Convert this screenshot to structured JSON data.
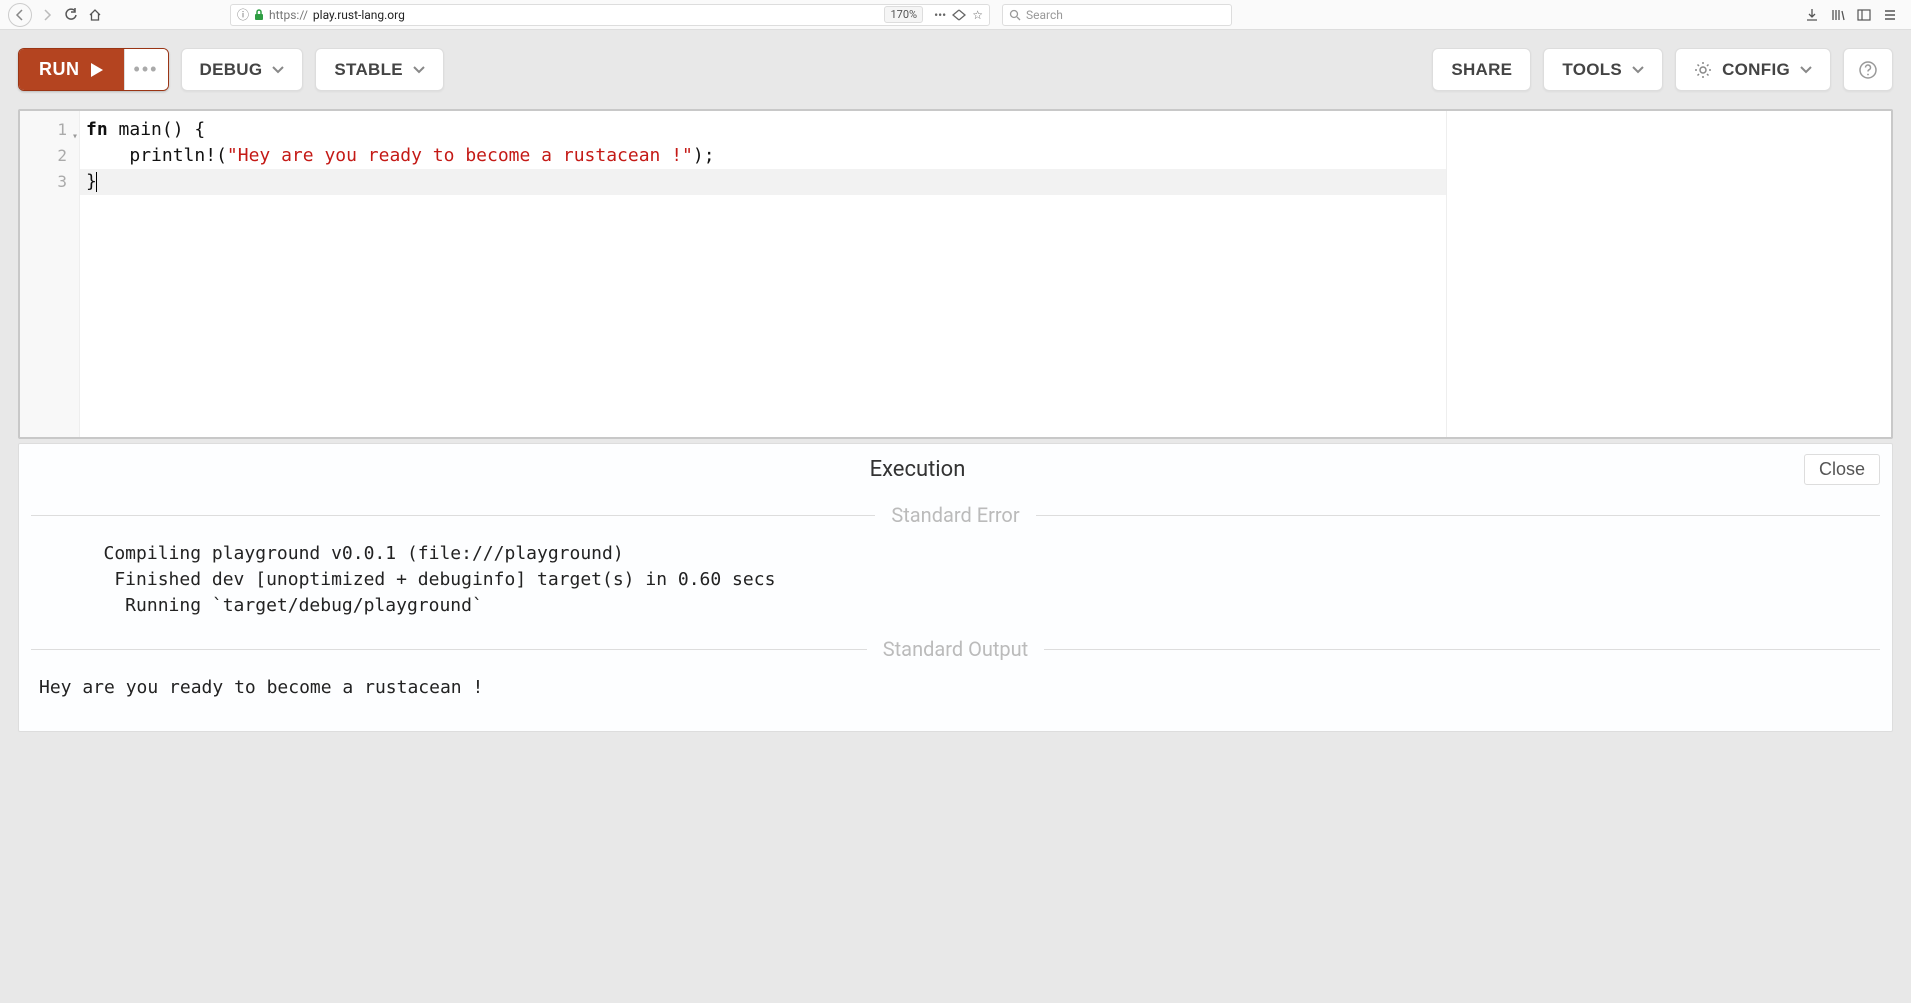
{
  "browser": {
    "url_prefix": "https://",
    "url_host": "play.rust-lang.org",
    "zoom": "170%",
    "search_placeholder": "Search"
  },
  "toolbar": {
    "run_label": "RUN",
    "debug_label": "DEBUG",
    "stable_label": "STABLE",
    "share_label": "SHARE",
    "tools_label": "TOOLS",
    "config_label": "CONFIG"
  },
  "editor": {
    "lines": [
      {
        "n": "1",
        "fold": true
      },
      {
        "n": "2",
        "fold": false
      },
      {
        "n": "3",
        "fold": false
      }
    ],
    "code": {
      "l1_kw": "fn",
      "l1_rest": " main() {",
      "l2_indent": "    ",
      "l2_call": "println!",
      "l2_paren_open": "(",
      "l2_str": "\"Hey are you ready to become a rustacean !\"",
      "l2_paren_close": ");",
      "l3": "}"
    }
  },
  "output": {
    "title": "Execution",
    "close_label": "Close",
    "stderr_label": "Standard Error",
    "stdout_label": "Standard Output",
    "stderr_text": "   Compiling playground v0.0.1 (file:///playground)\n    Finished dev [unoptimized + debuginfo] target(s) in 0.60 secs\n     Running `target/debug/playground`",
    "stdout_text": "Hey are you ready to become a rustacean !"
  }
}
